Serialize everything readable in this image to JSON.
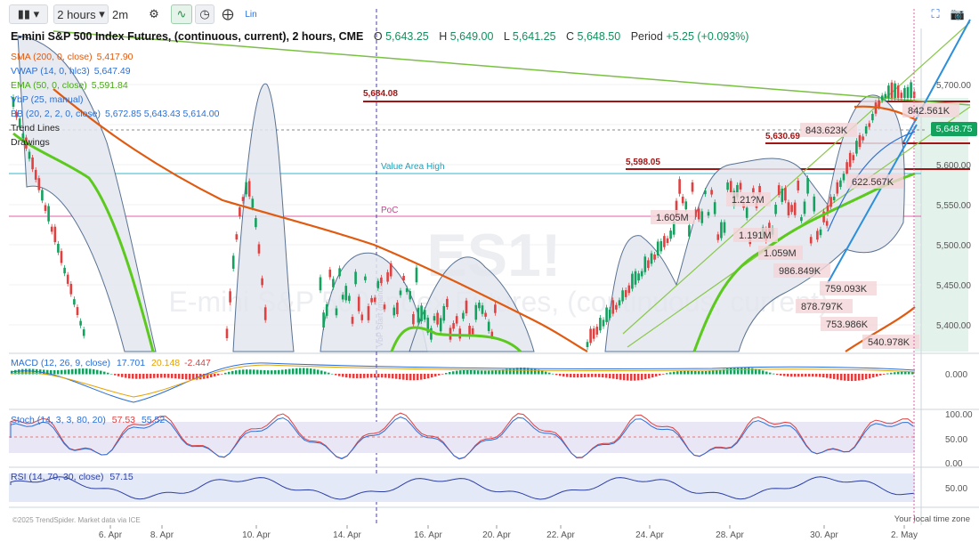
{
  "toolbar": {
    "symbol_icon": "candlestick-icon",
    "interval_label": "2 hours",
    "interval_sub": "2m",
    "gear_icon": "gear-icon",
    "tools": [
      "line-tool-icon",
      "clock-icon",
      "crosshair-icon"
    ],
    "lin_label": "Lin",
    "fullscreen_icon": "fullscreen-icon",
    "camera_icon": "camera-icon"
  },
  "header": {
    "title": "E-mini S&P 500 Index Futures, (continuous, current), 2 hours, CME",
    "open_label": "O",
    "open": "5,643.25",
    "high_label": "H",
    "high": "5,649.00",
    "low_label": "L",
    "low": "5,641.25",
    "close_label": "C",
    "close": "5,648.50",
    "period_label": "Period",
    "period": "+5.25 (+0.093%)"
  },
  "indicators": [
    {
      "name": "SMA (200, 0, close)",
      "value": "5,417.90",
      "color": "#e05a10"
    },
    {
      "name": "VWAP (14, 0, hlc3)",
      "value": "5,647.49",
      "color": "#2b6fd6"
    },
    {
      "name": "EMA (50, 0, close)",
      "value": "5,591.84",
      "color": "#5cc91e"
    },
    {
      "name": "VbP (25, manual)",
      "value": "",
      "color": "#2b6fd6"
    },
    {
      "name": "BB (20, 2, 2, 0, close)",
      "value": "5,672.85   5,643.43   5,614.00",
      "color": "#2b6fd6"
    },
    {
      "name": "Trend Lines",
      "value": "",
      "color": "#222"
    },
    {
      "name": "Drawings",
      "value": "",
      "color": "#222"
    }
  ],
  "watermark": {
    "symbol": "ES1!",
    "name": "E-mini S&P 500 Index Futures, (continuous, current)"
  },
  "annotations": {
    "value_area_high": "Value Area High",
    "poc": "PoC",
    "vbp_start": "VbP Start (manual)",
    "level_5684": "5,684.08",
    "level_5630": "5,630.69",
    "level_5598": "5,598.05"
  },
  "volume_labels": [
    "842.561K",
    "843.623K",
    "622.567K",
    "1.21?M",
    "1.605M",
    "1.191M",
    "1.059M",
    "986.849K",
    "759.093K",
    "878.797K",
    "753.986K",
    "540.978K"
  ],
  "chart_data": {
    "type": "candlestick",
    "price_axis_ticks": [
      "5,700.00",
      "5,650.00",
      "5,600.00",
      "5,550.00",
      "5,500.00",
      "5,450.00",
      "5,400.00"
    ],
    "price_axis_values": [
      5700,
      5650,
      5600,
      5550,
      5500,
      5450,
      5400
    ],
    "current_price": "5,648.75",
    "current_value": 5648.75,
    "x_ticks": [
      "6. Apr",
      "8. Apr",
      "10. Apr",
      "14. Apr",
      "16. Apr",
      "20. Apr",
      "22. Apr",
      "24. Apr",
      "28. Apr",
      "30. Apr",
      "2. May"
    ],
    "horizontal_levels": [
      5684.08,
      5630.69,
      5598.05
    ]
  },
  "macd": {
    "label": "MACD (12, 26, 9, close)",
    "v1": "17.701",
    "v2": "20.148",
    "v3": "-2.447",
    "axis": "0.000"
  },
  "stoch": {
    "label": "Stoch (14, 3, 3, 80, 20)",
    "v1": "57.53",
    "v2": "55.52",
    "axis": [
      "100.00",
      "50.00",
      "0.00"
    ]
  },
  "rsi": {
    "label": "RSI (14, 70, 30, close)",
    "v1": "57.15",
    "axis": "50.00"
  },
  "footer": {
    "copyright": "©2025 TrendSpider. Market data via ICE",
    "timezone": "Your local time zone"
  }
}
